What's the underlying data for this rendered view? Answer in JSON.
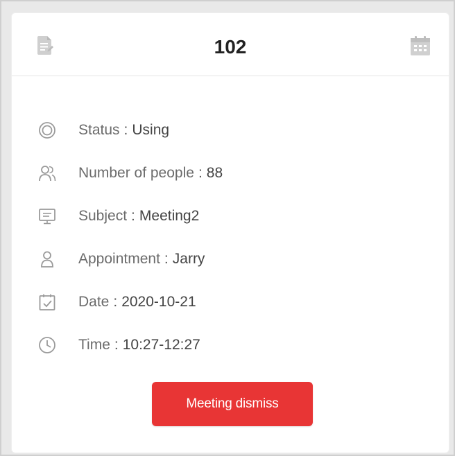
{
  "card": {
    "title": "102",
    "header_left_icon": "document-icon",
    "header_right_icon": "calendar-icon"
  },
  "info": [
    {
      "icon": "status-icon",
      "label": "Status",
      "separator": ":",
      "value": "Using"
    },
    {
      "icon": "people-icon",
      "label": "Number of people",
      "separator": ":",
      "value": "88"
    },
    {
      "icon": "subject-icon",
      "label": "Subject",
      "separator": ":",
      "value": "Meeting2"
    },
    {
      "icon": "person-icon",
      "label": "Appointment",
      "separator": ":",
      "value": "Jarry"
    },
    {
      "icon": "date-check-icon",
      "label": "Date",
      "separator": ":",
      "value": "2020-10-21"
    },
    {
      "icon": "clock-icon",
      "label": "Time",
      "separator": ":",
      "value": "10:27-12:27"
    }
  ],
  "button": {
    "label": "Meeting dismiss",
    "color": "#e83535"
  },
  "colors": {
    "icon_gray": "#9a9a9a",
    "header_icon_gray": "#c7c7c7"
  }
}
